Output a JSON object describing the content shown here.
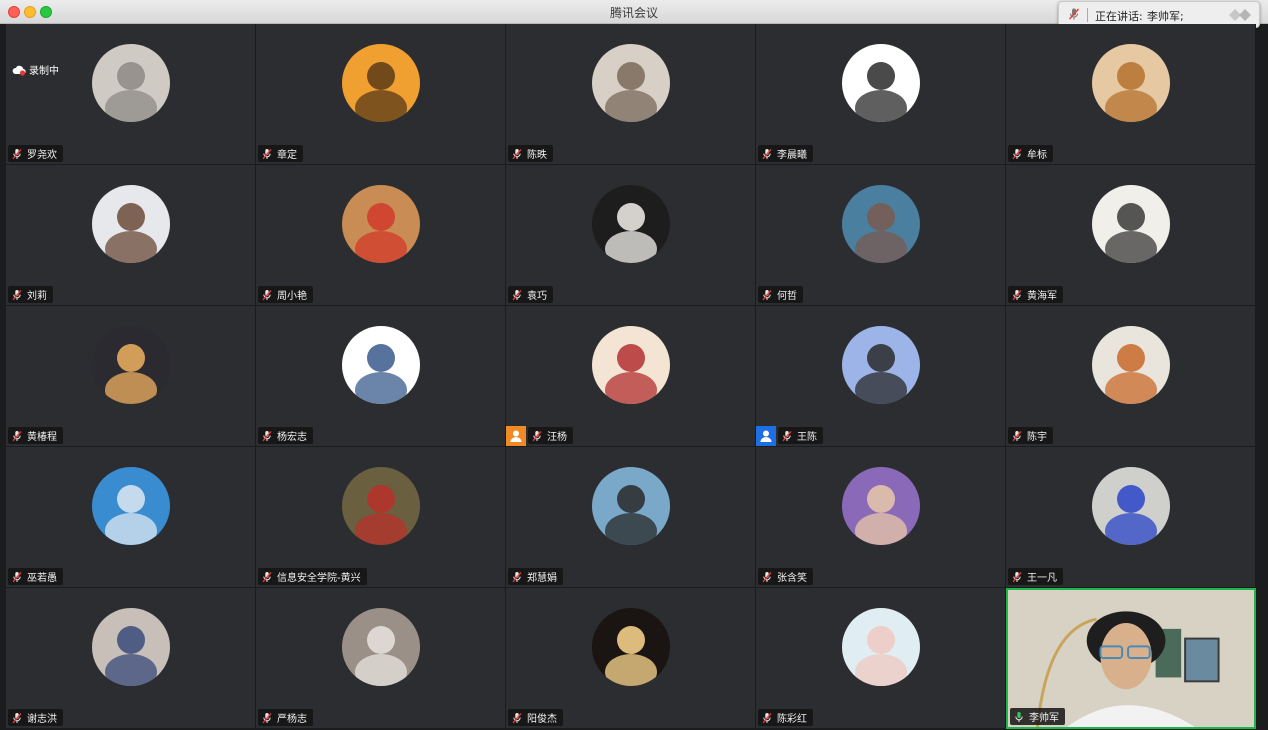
{
  "window": {
    "title": "腾讯会议"
  },
  "speaking": {
    "label": "正在讲话:",
    "name": "李帅军;"
  },
  "recording": {
    "label": "录制中"
  },
  "participants": [
    {
      "name": "罗尧欢",
      "avatar": "gray-cat-toy",
      "bg": "#cfcac4",
      "fg": "#8e8a85"
    },
    {
      "name": "章定",
      "avatar": "sunset-towers",
      "bg": "#f0a030",
      "fg": "#5a3a18"
    },
    {
      "name": "陈昳",
      "avatar": "white-dog",
      "bg": "#d8d0c6",
      "fg": "#7a6a5a"
    },
    {
      "name": "李晨曦",
      "avatar": "cartoon-bear",
      "bg": "#ffffff",
      "fg": "#2a2a2a"
    },
    {
      "name": "牟标",
      "avatar": "corgi",
      "bg": "#e6c9a3",
      "fg": "#b5722e"
    },
    {
      "name": "刘莉",
      "avatar": "girl-window",
      "bg": "#e7e8ec",
      "fg": "#6b4a3a"
    },
    {
      "name": "周小艳",
      "avatar": "desert-woman",
      "bg": "#c88c54",
      "fg": "#d23a2a"
    },
    {
      "name": "袁巧",
      "avatar": "samoyed",
      "bg": "#1d1d1d",
      "fg": "#f4f1ec"
    },
    {
      "name": "何哲",
      "avatar": "man-sunglasses",
      "bg": "#4a7f9f",
      "fg": "#7a5a50"
    },
    {
      "name": "黄海军",
      "avatar": "ink-figure",
      "bg": "#f1efea",
      "fg": "#3a3a3a"
    },
    {
      "name": "黄椿程",
      "avatar": "woman-sunlight",
      "bg": "#2a2a30",
      "fg": "#f0b060"
    },
    {
      "name": "杨宏志",
      "avatar": "cartoon-hat-boy",
      "bg": "#ffffff",
      "fg": "#3a5b8c"
    },
    {
      "name": "汪杨",
      "avatar": "shinchan",
      "bg": "#f3e4d4",
      "fg": "#b33030",
      "badge": "#f08a24"
    },
    {
      "name": "王陈",
      "avatar": "blue-sky-girl",
      "bg": "#9cb4e8",
      "fg": "#2a2a2a",
      "badge": "#1e6fe6"
    },
    {
      "name": "陈宇",
      "avatar": "man-sitting",
      "bg": "#e9e5dd",
      "fg": "#c86a2a"
    },
    {
      "name": "巫若愚",
      "avatar": "blue-road",
      "bg": "#3a8cd0",
      "fg": "#dfe8f2"
    },
    {
      "name": "信息安全学院-黄兴",
      "avatar": "man-red-shirt",
      "bg": "#6a6040",
      "fg": "#b8302a"
    },
    {
      "name": "郑慧娟",
      "avatar": "seaside-woman",
      "bg": "#7aa8c8",
      "fg": "#2a2a2a"
    },
    {
      "name": "张含笑",
      "avatar": "woman-flowers",
      "bg": "#8a6ab8",
      "fg": "#e8c8a8"
    },
    {
      "name": "王一凡",
      "avatar": "blue-cube",
      "bg": "#cfd0cc",
      "fg": "#2a44c8"
    },
    {
      "name": "谢志洪",
      "avatar": "kids-park",
      "bg": "#c8c0b8",
      "fg": "#3a4a7a"
    },
    {
      "name": "严杨志",
      "avatar": "gray-cat",
      "bg": "#9a9088",
      "fg": "#e8e4e0"
    },
    {
      "name": "阳俊杰",
      "avatar": "sparklers",
      "bg": "#1a1412",
      "fg": "#ffd890"
    },
    {
      "name": "陈彩红",
      "avatar": "little-girl",
      "bg": "#e0eef4",
      "fg": "#f0c8c0"
    },
    {
      "name": "李帅军",
      "avatar": "live-video",
      "bg": "#d8d2c4",
      "fg": "#1e1e1e",
      "active": true
    }
  ],
  "colors": {
    "active_border": "#1eb64a",
    "tile_bg": "#2b2d30",
    "rec_dot": "#e53935"
  }
}
